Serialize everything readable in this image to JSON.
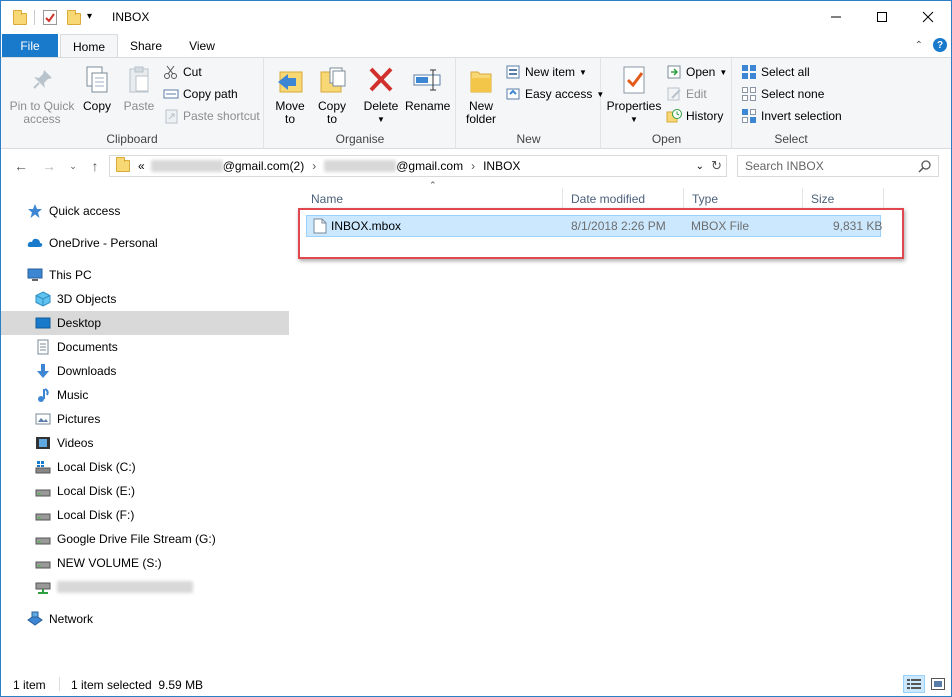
{
  "window": {
    "title": "INBOX"
  },
  "tabs": {
    "file": "File",
    "home": "Home",
    "share": "Share",
    "view": "View"
  },
  "ribbon": {
    "clipboard": {
      "label": "Clipboard",
      "pin": "Pin to Quick\naccess",
      "copy": "Copy",
      "paste": "Paste",
      "cut": "Cut",
      "copy_path": "Copy path",
      "paste_shortcut": "Paste shortcut"
    },
    "organise": {
      "label": "Organise",
      "move_to": "Move\nto",
      "copy_to": "Copy\nto",
      "delete": "Delete",
      "rename": "Rename"
    },
    "new": {
      "label": "New",
      "new_folder": "New\nfolder",
      "new_item": "New item",
      "easy_access": "Easy access"
    },
    "open": {
      "label": "Open",
      "properties": "Properties",
      "open": "Open",
      "edit": "Edit",
      "history": "History"
    },
    "select": {
      "label": "Select",
      "select_all": "Select all",
      "select_none": "Select none",
      "invert_selection": "Invert selection"
    }
  },
  "address": {
    "prefix": "«",
    "crumb1_suffix": "@gmail.com(2)",
    "crumb2_suffix": "@gmail.com",
    "crumb3": "INBOX",
    "separator": "›"
  },
  "search": {
    "placeholder": "Search INBOX"
  },
  "nav": {
    "quick_access": "Quick access",
    "onedrive": "OneDrive - Personal",
    "this_pc": "This PC",
    "objects_3d": "3D Objects",
    "desktop": "Desktop",
    "documents": "Documents",
    "downloads": "Downloads",
    "music": "Music",
    "pictures": "Pictures",
    "videos": "Videos",
    "local_c": "Local Disk (C:)",
    "local_e": "Local Disk (E:)",
    "local_f": "Local Disk (F:)",
    "google_drive": "Google Drive File Stream (G:)",
    "new_volume": "NEW VOLUME (S:)",
    "network": "Network"
  },
  "columns": {
    "name": "Name",
    "date": "Date modified",
    "type": "Type",
    "size": "Size"
  },
  "files": [
    {
      "name": "INBOX.mbox",
      "date": "8/1/2018 2:26 PM",
      "type": "MBOX File",
      "size": "9,831 KB"
    }
  ],
  "status": {
    "count": "1 item",
    "selected": "1 item selected  9.59 MB"
  },
  "colors": {
    "accent": "#1979ca",
    "selection": "#cce8ff",
    "highlight_box": "#e0474f"
  }
}
